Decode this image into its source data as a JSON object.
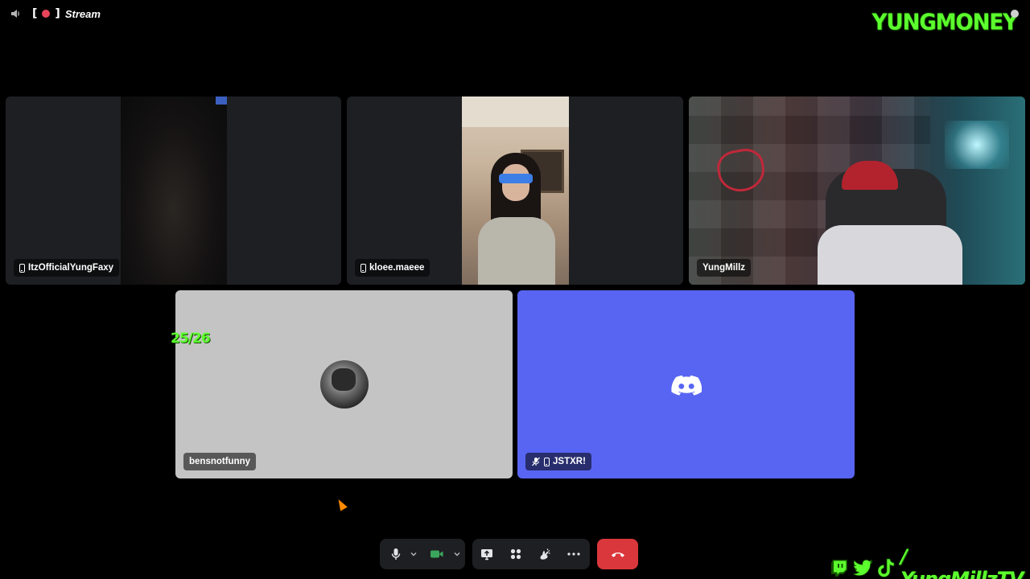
{
  "topbar": {
    "stream_label": "Stream",
    "brand": "YUNGMONEY"
  },
  "participants": [
    {
      "name": "ItzOfficialYungFaxy",
      "device": "phone-icon",
      "speaking": false
    },
    {
      "name": "kloee.maeee",
      "device": "phone-icon",
      "speaking": false
    },
    {
      "name": "YungMillz",
      "device": null,
      "speaking": true
    },
    {
      "name": "bensnotfunny",
      "device": null,
      "speaking": false
    },
    {
      "name": "JSTXR!",
      "device": "phone-icon",
      "muted": true,
      "speaking": false
    }
  ],
  "overlay": {
    "counter": "25/26",
    "socials_handle": "/ YungMillzTV"
  },
  "colors": {
    "brand_green": "#5cff2e",
    "discord_blurple": "#5865f2",
    "speaking_ring": "#3ba55c",
    "leave_red": "#da373c",
    "tile_bg": "#1e1f22",
    "avatar_tile_bg": "#c4c4c4"
  },
  "controls": [
    {
      "name": "microphone",
      "icon": "microphone-icon"
    },
    {
      "name": "microphone-options",
      "icon": "chevron-down-icon"
    },
    {
      "name": "camera",
      "icon": "camera-icon",
      "active": true
    },
    {
      "name": "camera-options",
      "icon": "chevron-down-icon"
    },
    {
      "name": "share-screen",
      "icon": "screen-share-icon"
    },
    {
      "name": "activities",
      "icon": "activities-icon"
    },
    {
      "name": "soundboard",
      "icon": "soundboard-icon"
    },
    {
      "name": "more",
      "icon": "more-icon"
    },
    {
      "name": "disconnect",
      "icon": "hang-up-icon"
    }
  ]
}
